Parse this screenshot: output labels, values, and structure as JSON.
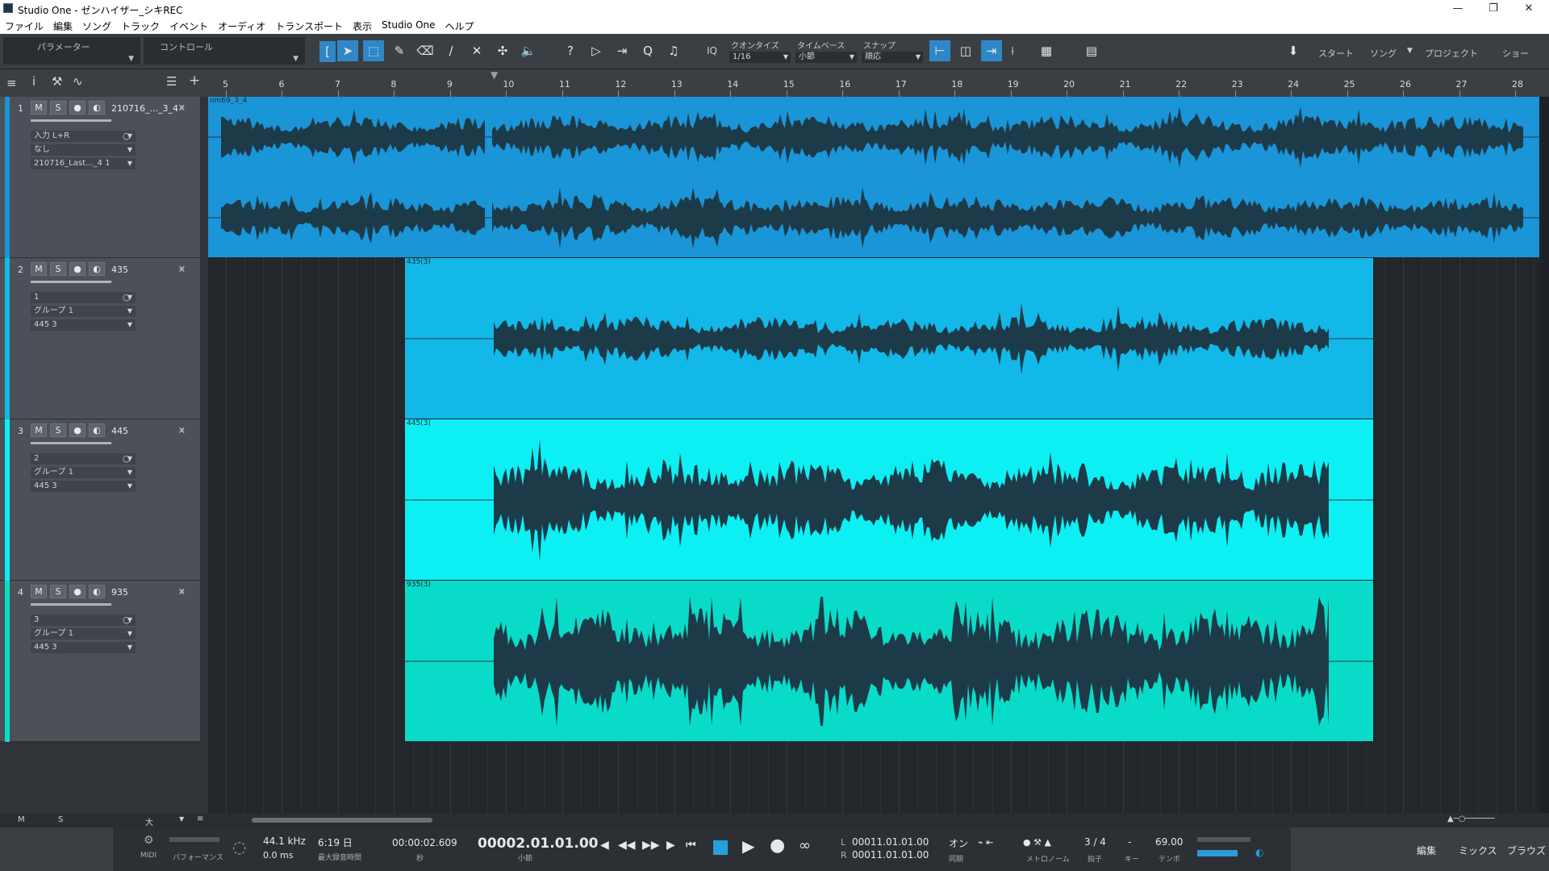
{
  "window": {
    "title": "Studio One - ゼンハイザー_シキREC",
    "min": "—",
    "max": "❐",
    "close": "✕"
  },
  "menu": [
    "ファイル",
    "編集",
    "ソング",
    "トラック",
    "イベント",
    "オーディオ",
    "トランスポート",
    "表示",
    "Studio One",
    "ヘルプ"
  ],
  "toolbar": {
    "parameter": "パラメーター",
    "control": "コントロール",
    "iq": "IQ",
    "quantize_label": "クオンタイズ",
    "quantize_value": "1/16",
    "timebase_label": "タイムベース",
    "timebase_value": "小節",
    "snap_label": "スナップ",
    "snap_value": "順応",
    "start": "スタート",
    "song": "ソング",
    "project": "プロジェクト",
    "show": "ショー"
  },
  "ruler": [
    "5",
    "6",
    "7",
    "8",
    "9",
    "10",
    "11",
    "12",
    "13",
    "14",
    "15",
    "16",
    "17",
    "18",
    "19",
    "20",
    "21",
    "22",
    "23",
    "24",
    "25",
    "26",
    "27",
    "28"
  ],
  "tracks": [
    {
      "num": "1",
      "name": "210716_..._3_4",
      "row1": "入力 L+R",
      "row2": "なし",
      "row3": "210716_Last..._4 1",
      "event": "om69_3_4"
    },
    {
      "num": "2",
      "name": "435",
      "row1": "1",
      "row2": "グループ 1",
      "row3": "445 3",
      "event": "435(3)"
    },
    {
      "num": "3",
      "name": "445",
      "row1": "2",
      "row2": "グループ 1",
      "row3": "445 3",
      "event": "445(3)"
    },
    {
      "num": "4",
      "name": "935",
      "row1": "3",
      "row2": "グループ 1",
      "row3": "445 3",
      "event": "935(3)"
    }
  ],
  "track_buttons": {
    "m": "M",
    "s": "S"
  },
  "bottom_strip": {
    "m": "M",
    "s": "S",
    "size": "大"
  },
  "transport": {
    "midi": "MIDI",
    "perf": "パフォーマンス",
    "samplerate": "44.1 kHz",
    "latency": "0.0 ms",
    "rec_time": "6:19 日",
    "rec_time_label": "最大録音時間",
    "seconds": "00:00:02.609",
    "seconds_label": "秒",
    "bars": "00002.01.01.00",
    "bars_label": "小節",
    "loop_l": "00011.01.01.00",
    "loop_r": "00011.01.01.00",
    "L": "L",
    "R": "R",
    "sync": "オン",
    "sync_label": "同期",
    "metronome_label": "メトロノーム",
    "timesig": "3 / 4",
    "timesig_label": "拍子",
    "key": "-",
    "key_label": "キー",
    "tempo": "69.00",
    "tempo_label": "テンポ",
    "edit": "編集",
    "mix": "ミックス",
    "browse": "ブラウズ"
  },
  "colors": {
    "track1": "#1a95d8",
    "track2": "#12b8e8",
    "track3": "#0cf0f4",
    "track4": "#08dcc8",
    "wave": "#1d3a48"
  }
}
